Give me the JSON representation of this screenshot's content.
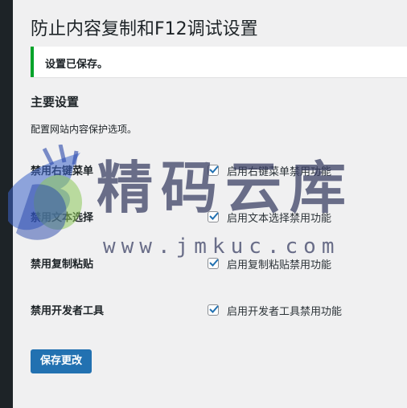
{
  "page": {
    "title": "防止内容复制和F12调试设置"
  },
  "notice": {
    "text": "设置已保存。",
    "color": "#00a32a"
  },
  "section": {
    "title": "主要设置",
    "description": "配置网站内容保护选项。"
  },
  "settings": [
    {
      "label": "禁用右键菜单",
      "checkbox_label": "启用右键菜单禁用功能",
      "checked": true
    },
    {
      "label": "禁用文本选择",
      "checkbox_label": "启用文本选择禁用功能",
      "checked": true
    },
    {
      "label": "禁用复制粘贴",
      "checkbox_label": "启用复制粘贴禁用功能",
      "checked": true
    },
    {
      "label": "禁用开发者工具",
      "checkbox_label": "启用开发者工具禁用功能",
      "checked": true
    }
  ],
  "save_button": {
    "label": "保存更改",
    "color": "#2271b1"
  },
  "watermark": {
    "name": "精码云库",
    "url": "www.jmkuc.com"
  }
}
